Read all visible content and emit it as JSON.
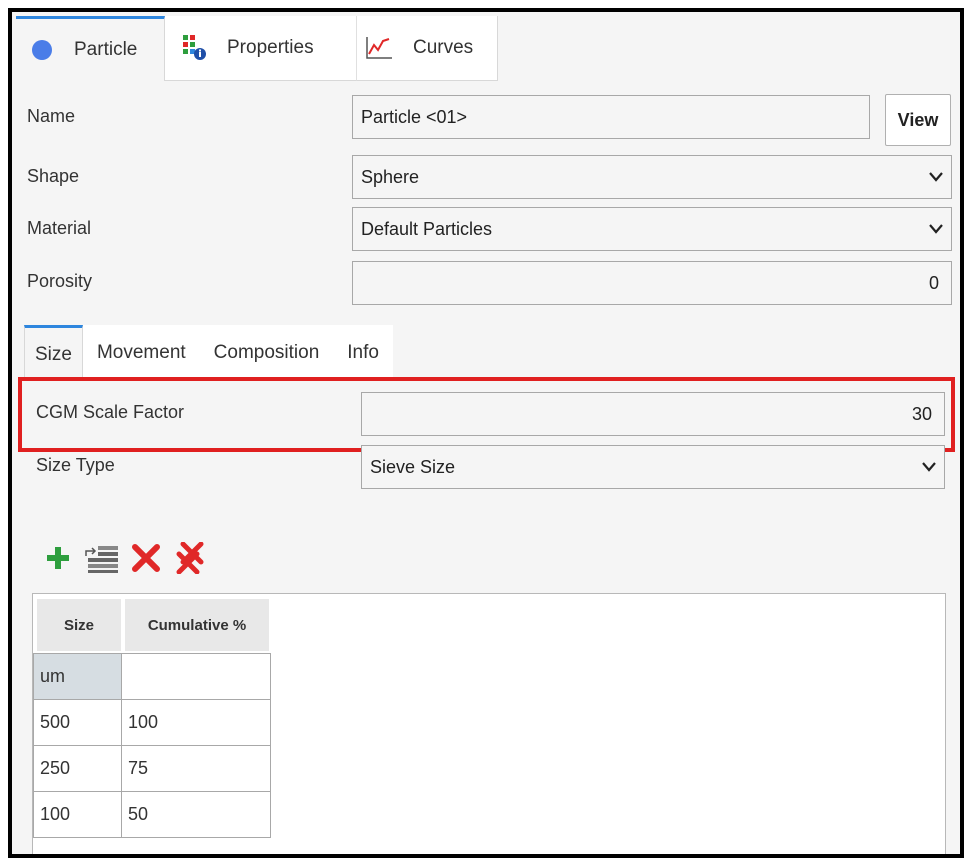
{
  "tabs": {
    "particle": "Particle",
    "properties": "Properties",
    "curves": "Curves"
  },
  "form": {
    "name_label": "Name",
    "name_value": "Particle <01>",
    "view_button": "View",
    "shape_label": "Shape",
    "shape_value": "Sphere",
    "material_label": "Material",
    "material_value": "Default Particles",
    "porosity_label": "Porosity",
    "porosity_value": "0"
  },
  "subtabs": {
    "size": "Size",
    "movement": "Movement",
    "composition": "Composition",
    "info": "Info"
  },
  "size_tab": {
    "cgm_label": "CGM Scale Factor",
    "cgm_value": "30",
    "size_type_label": "Size Type",
    "size_type_value": "Sieve Size"
  },
  "table": {
    "headers": [
      "Size",
      "Cumulative %"
    ],
    "unit_row": [
      "um",
      ""
    ],
    "rows": [
      [
        "500",
        "100"
      ],
      [
        "250",
        "75"
      ],
      [
        "100",
        "50"
      ]
    ]
  },
  "colors": {
    "accent": "#2e86de",
    "highlight": "#e02020",
    "particle_dot": "#4a7de8",
    "add_green": "#2e9e3e",
    "delete_red": "#e02828"
  },
  "icons": [
    "particle-dot-icon",
    "properties-icon",
    "curves-icon",
    "add-icon",
    "insert-row-icon",
    "delete-icon",
    "delete-all-icon",
    "chevron-down-icon"
  ]
}
